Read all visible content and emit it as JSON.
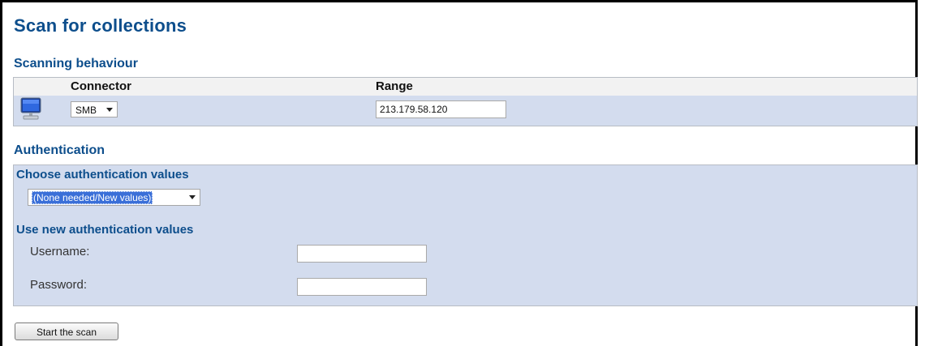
{
  "page_title": "Scan for collections",
  "scanning": {
    "heading": "Scanning behaviour",
    "columns": {
      "connector": "Connector",
      "range": "Range"
    },
    "row": {
      "connector_value": "SMB",
      "range_value": "213.179.58.120"
    }
  },
  "auth": {
    "heading": "Authentication",
    "choose_heading": "Choose authentication values",
    "choose_value": "(None needed/New values)",
    "new_heading": "Use new authentication values",
    "username_label": "Username:",
    "password_label": "Password:",
    "username_value": "",
    "password_value": ""
  },
  "actions": {
    "start_label": "Start the scan"
  },
  "icons": {
    "row_icon": "computer-monitor-icon"
  }
}
